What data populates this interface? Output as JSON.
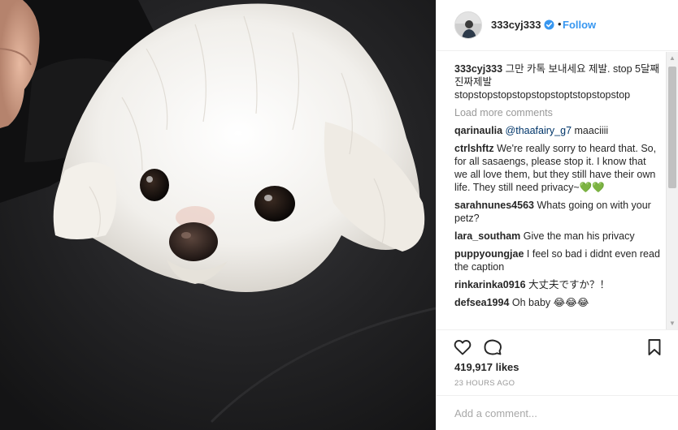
{
  "post": {
    "username": "333cyj333",
    "follow_label": "Follow",
    "separator": "•",
    "photo_icon": "dog-photo"
  },
  "caption": {
    "username": "333cyj333",
    "text": "그만 카톡 보내세요 제발. stop 5달째 진짜제발 stopstopstopstopstopstoptstopstopstop"
  },
  "load_more_label": "Load more comments",
  "comments": [
    {
      "username": "qarinaulia",
      "mention": "@thaafairy_g7",
      "text": " maaciiii"
    },
    {
      "username": "ctrlshftz",
      "mention": "",
      "text": "We're really sorry to heard that. So, for all sasaengs, please stop it. I know that we all love them, but they still have their own life. They still need privacy~💚💚"
    },
    {
      "username": "sarahnunes4563",
      "mention": "",
      "text": "Whats going on with your petz?"
    },
    {
      "username": "lara_southam",
      "mention": "",
      "text": "Give the man his privacy"
    },
    {
      "username": "puppyoungjae",
      "mention": "",
      "text": "I feel so bad i didnt even read the caption"
    },
    {
      "username": "rinkarinka0916",
      "mention": "",
      "text": "大丈夫ですか？！"
    },
    {
      "username": "defsea1994",
      "mention": "",
      "text": "Oh baby 😂😂😂"
    }
  ],
  "likes": "419,917 likes",
  "time_ago": "23 HOURS AGO",
  "add_comment": {
    "placeholder": "Add a comment..."
  },
  "colors": {
    "link": "#3897f0",
    "mention": "#003569",
    "muted": "#999999",
    "verified": "#3897f0",
    "dog_fur": "#f4f2ee",
    "leather": "#1d1d1f"
  }
}
